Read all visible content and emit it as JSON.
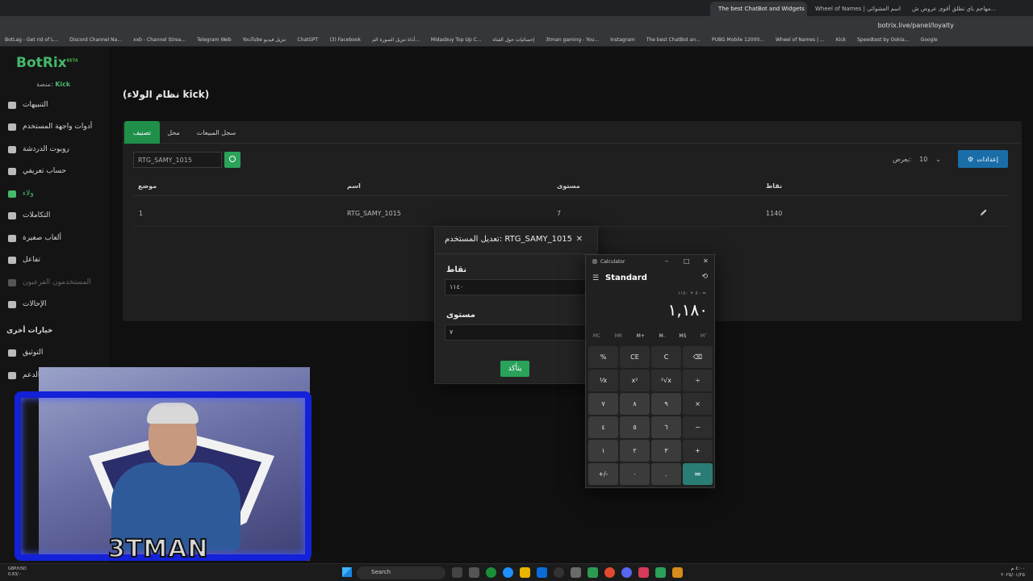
{
  "browser": {
    "tabs": [
      {
        "label": "The best ChatBot and Widgets",
        "active": true
      },
      {
        "label": "Wheel of Names | اسم العشوائي",
        "active": false
      },
      {
        "label": "مهاجم باي تطلق أقوى عروض ش...",
        "active": false
      }
    ],
    "url": "botrix.live/panel/loyalty",
    "bookmarks": [
      "BotLag - Get rid of L...",
      "Discord Channel Na...",
      "xxb - Channel Strea...",
      "Telegram Web",
      "YouTube تنزيل فيديو",
      "ChatGPT",
      "(3) Facebook",
      "أداة تنزيل الصورة الم...",
      "Midasbuy Top Up C...",
      "إحصائيات حول القناة",
      "3tman gaming - You...",
      "Instagram",
      "The best ChatBot an...",
      "PUBG Mobile 12000...",
      "Wheel of Names | ...",
      "Kick",
      "Speedtest by Ookla...",
      "Google"
    ]
  },
  "sidebar": {
    "logo": "BotRix",
    "logo_beta": "BETA",
    "logo_sub_platform": "Kick",
    "logo_sub_label": "منصة:",
    "items": [
      {
        "label": "التنبيهات",
        "icon": "alert-icon"
      },
      {
        "label": "أدوات واجهة المستخدم",
        "icon": "widgets-icon"
      },
      {
        "label": "روبوت الدردشة",
        "icon": "chat-icon"
      },
      {
        "label": "حساب تعريفي",
        "icon": "profile-icon"
      },
      {
        "label": "ولاء",
        "icon": "loyalty-icon"
      },
      {
        "label": "التكاملات",
        "icon": "integrations-icon"
      },
      {
        "label": "ألعاب صغيرة",
        "icon": "games-icon"
      },
      {
        "label": "تفاعل",
        "icon": "music-icon"
      },
      {
        "label": "المستخدمون الفرعيون",
        "icon": "subusers-icon"
      },
      {
        "label": "الإحالات",
        "icon": "referrals-icon"
      }
    ],
    "more_heading": "خيارات أخرى",
    "more_items": [
      {
        "label": "التوثيق",
        "icon": "docs-icon"
      },
      {
        "label": "الدعم",
        "icon": "help-icon"
      }
    ]
  },
  "main": {
    "title": "(نظام الولاء kick)",
    "tabs": [
      "تصنيف",
      "محل",
      "سجل المبيعات"
    ],
    "search_value": "RTG_SAMY_1015",
    "settings_label": "إعدادات",
    "show_label": "يعرض:",
    "show_count": "10",
    "columns": [
      "موضع",
      "اسم",
      "مستوى",
      "نقاط"
    ],
    "rows": [
      {
        "position": "1",
        "name": "RTG_SAMY_1015",
        "level": "7",
        "points": "1140"
      }
    ]
  },
  "modal": {
    "title": "تعديل المستخدم: RTG_SAMY_1015",
    "points_label": "نقاط",
    "points_value": "١١٤٠",
    "level_label": "مستوى",
    "level_value": "٧",
    "confirm_label": "يتأكد"
  },
  "calculator": {
    "window_title": "Calculator",
    "mode": "Standard",
    "expression": "٤٠ + ١١٤٠ =",
    "display": "١,١٨٠",
    "memory": [
      "MC",
      "MR",
      "M+",
      "M-",
      "MS",
      "M˅"
    ],
    "keys": [
      "%",
      "CE",
      "C",
      "⌫",
      "⅟x",
      "x²",
      "²√x",
      "÷",
      "٧",
      "٨",
      "٩",
      "×",
      "٤",
      "٥",
      "٦",
      "−",
      "١",
      "٢",
      "٣",
      "+",
      "+/-",
      "٠",
      ".",
      "="
    ]
  },
  "webcam": {
    "overlay_name": "3TMAN"
  },
  "taskbar": {
    "search_placeholder": "Search",
    "ticker": "GBP/USD",
    "ticker_value": "0.83/ -",
    "time": "٤:٠٠ م",
    "date": "٢٠٢٥/٠١/٢٥"
  }
}
